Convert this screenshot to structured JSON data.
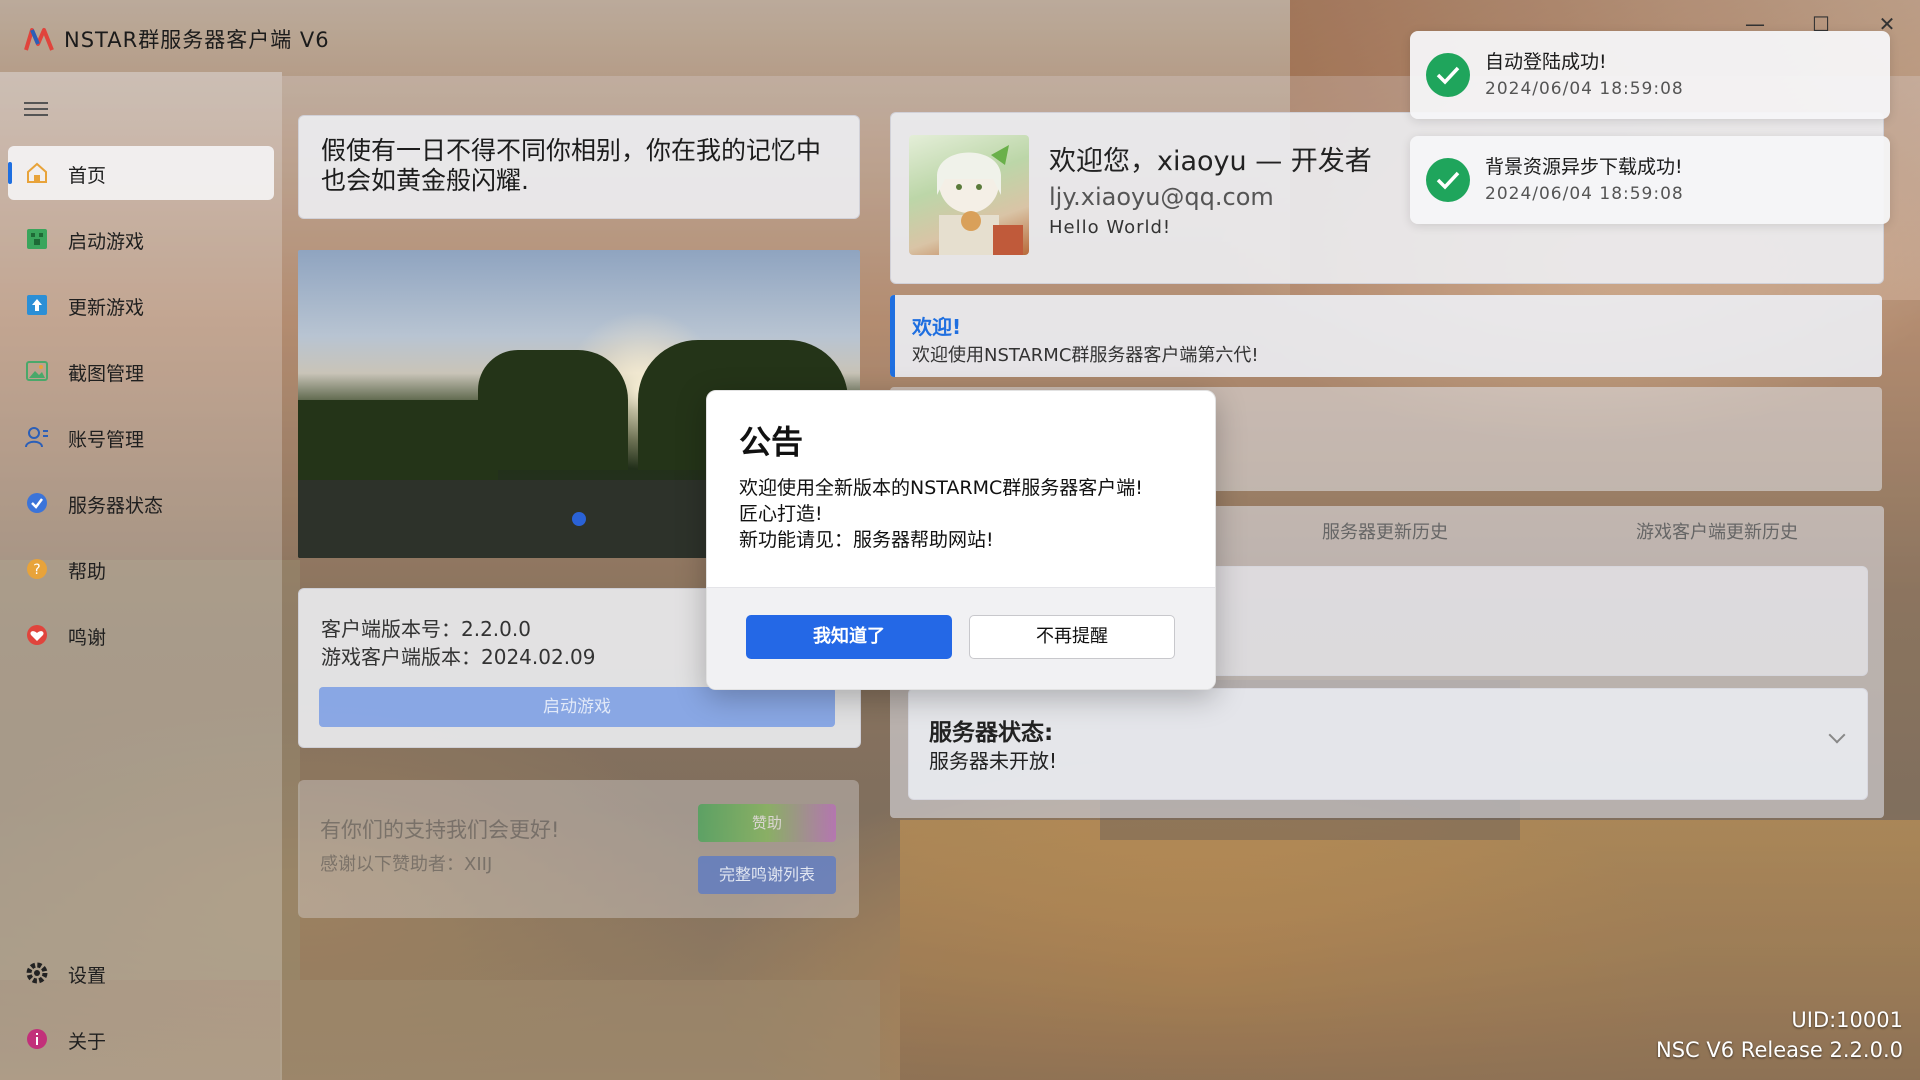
{
  "window": {
    "title": "NSTAR群服务器客户端 V6",
    "controls": [
      "minimize",
      "maximize",
      "close"
    ]
  },
  "sidebar": {
    "items": [
      {
        "label": "首页",
        "icon": "home-icon",
        "color": "#e8a33a"
      },
      {
        "label": "启动游戏",
        "icon": "game-icon",
        "color": "#3aa55c"
      },
      {
        "label": "更新游戏",
        "icon": "update-icon",
        "color": "#2b8fd6"
      },
      {
        "label": "截图管理",
        "icon": "image-icon",
        "color": "#4aa86a"
      },
      {
        "label": "账号管理",
        "icon": "account-icon",
        "color": "#2b5fb8"
      },
      {
        "label": "服务器状态",
        "icon": "server-status-icon",
        "color": "#3b74d9"
      },
      {
        "label": "帮助",
        "icon": "help-icon",
        "color": "#e8a33a"
      },
      {
        "label": "鸣谢",
        "icon": "thanks-icon",
        "color": "#e0443c"
      }
    ],
    "settings_label": "设置",
    "about_label": "关于"
  },
  "main": {
    "quote": "假使有一日不得不同你相别，你在我的记忆中也会如黄金般闪耀.",
    "client_version": "客户端版本号：2.2.0.0",
    "game_version": "游戏客户端版本：2024.02.09",
    "launch_button": "启动游戏",
    "support_text": "有你们的支持我们会更好!",
    "sponsors_text": "感谢以下赞助者：XIIJ",
    "sponsor_button": "赞助",
    "thanks_list_button": "完整鸣谢列表"
  },
  "user": {
    "welcome": "欢迎您，xiaoyu — 开发者",
    "email": "ljy.xiaoyu@qq.com",
    "motto": "Hello World!"
  },
  "welcome_banner": {
    "title": "欢迎!",
    "subtitle": "欢迎使用NSTARMC群服务器客户端第六代!"
  },
  "tabs": {
    "server_history": "服务器更新历史",
    "client_history": "游戏客户端更新历史"
  },
  "server_status": {
    "title": "服务器状态:",
    "value": "服务器未开放!"
  },
  "toasts": [
    {
      "title": "自动登陆成功!",
      "time": "2024/06/04 18:59:08"
    },
    {
      "title": "背景资源异步下载成功!",
      "time": "2024/06/04 18:59:08"
    }
  ],
  "footer": {
    "uid": "UID:10001",
    "release": "NSC V6 Release 2.2.0.0"
  },
  "dialog": {
    "title": "公告",
    "line1": "欢迎使用全新版本的NSTARMC群服务器客户端!",
    "line2": "匠心打造!",
    "line3": "新功能请见：服务器帮助网站!",
    "ok_button": "我知道了",
    "dismiss_button": "不再提醒"
  },
  "colors": {
    "accent": "#1f6fe0",
    "primary_button": "#2468e6",
    "success": "#1fa55c"
  }
}
